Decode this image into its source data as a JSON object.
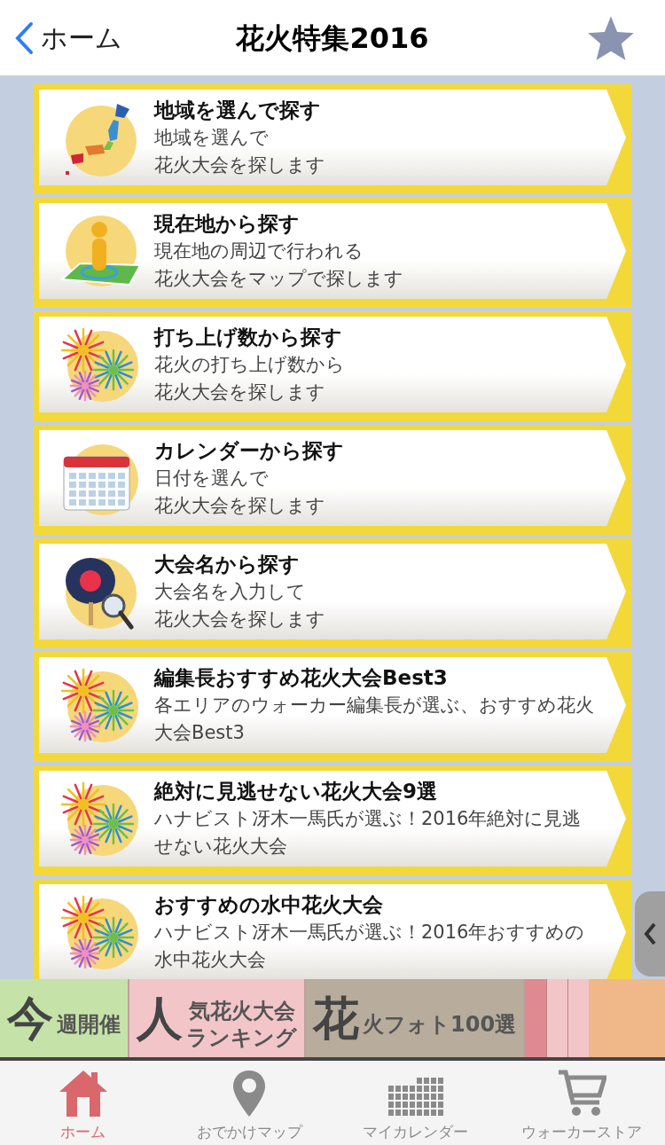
{
  "header": {
    "back_label": "ホーム",
    "title": "花火特集2016",
    "favorite": false
  },
  "menu_items": [
    {
      "kind": "japan-map",
      "title": "地域を選んで探す",
      "lines": [
        "地域を選んで",
        "花火大会を探します"
      ]
    },
    {
      "kind": "location",
      "title": "現在地から探す",
      "lines": [
        "現在地の周辺で行われる",
        "花火大会をマップで探します"
      ]
    },
    {
      "kind": "fireworks",
      "title": "打ち上げ数から探す",
      "lines": [
        "花火の打ち上げ数から",
        "花火大会を探します"
      ]
    },
    {
      "kind": "calendar",
      "title": "カレンダーから探す",
      "lines": [
        "日付を選んで",
        "花火大会を探します"
      ]
    },
    {
      "kind": "fan-search",
      "title": "大会名から探す",
      "lines": [
        "大会名を入力して",
        "花火大会を探します"
      ]
    },
    {
      "kind": "fireworks",
      "title": "編集長おすすめ花火大会Best3",
      "lines": [
        "各エリアのウォーカー編集長が選ぶ、おすすめ花火大会Best3"
      ]
    },
    {
      "kind": "fireworks",
      "title": "絶対に見逃せない花火大会9選",
      "lines": [
        "ハナビスト冴木一馬氏が選ぶ！2016年絶対に見逃せない花火大会"
      ]
    },
    {
      "kind": "fireworks",
      "title": "おすすめの水中花火大会",
      "lines": [
        "ハナビスト冴木一馬氏が選ぶ！2016年おすすめの水中花火大会"
      ]
    }
  ],
  "banners": [
    {
      "big": "今",
      "lines": [
        "週開催"
      ],
      "color": "#c5e3a8"
    },
    {
      "big": "人",
      "lines": [
        "気花火大会",
        "ランキング"
      ],
      "color": "#f2c6c8"
    },
    {
      "big": "花",
      "lines": [
        "火フォト100選"
      ],
      "color": "#b8ad9d"
    }
  ],
  "tabs": [
    {
      "label": "ホーム",
      "kind": "home",
      "selected": true
    },
    {
      "label": "おでかけマップ",
      "kind": "pin",
      "selected": false
    },
    {
      "label": "マイカレンダー",
      "kind": "grid",
      "selected": false
    },
    {
      "label": "ウォーカーストア",
      "kind": "cart",
      "selected": false
    }
  ]
}
